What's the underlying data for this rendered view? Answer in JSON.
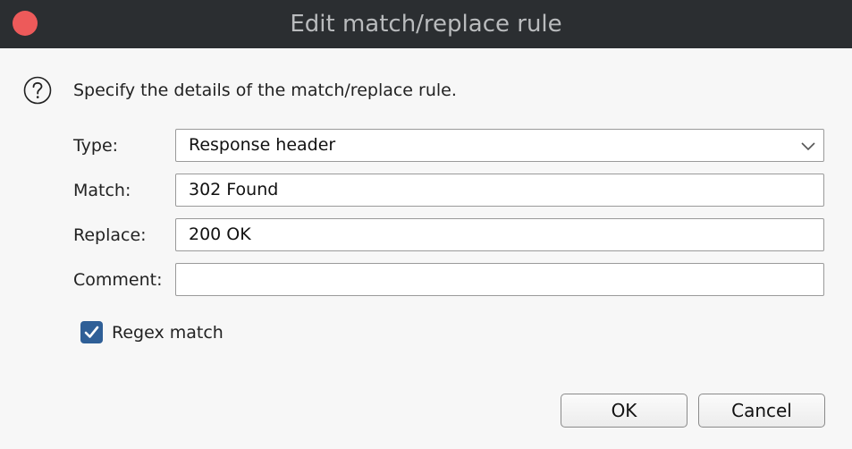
{
  "dialog": {
    "title": "Edit match/replace rule",
    "intro": "Specify the details of the match/replace rule."
  },
  "form": {
    "type_label": "Type:",
    "type_value": "Response header",
    "match_label": "Match:",
    "match_value": "302 Found",
    "replace_label": "Replace:",
    "replace_value": "200 OK",
    "comment_label": "Comment:",
    "comment_value": "",
    "regex_label": "Regex match",
    "regex_checked": true
  },
  "buttons": {
    "ok": "OK",
    "cancel": "Cancel"
  },
  "icons": {
    "close": "close-icon",
    "help": "help-circle-icon",
    "dropdown": "chevron-down-icon",
    "check": "checkmark-icon"
  },
  "colors": {
    "titlebar": "#2b2e31",
    "close_button": "#ed5a5a",
    "checkbox": "#2f5f97",
    "background": "#f7f7f7"
  }
}
